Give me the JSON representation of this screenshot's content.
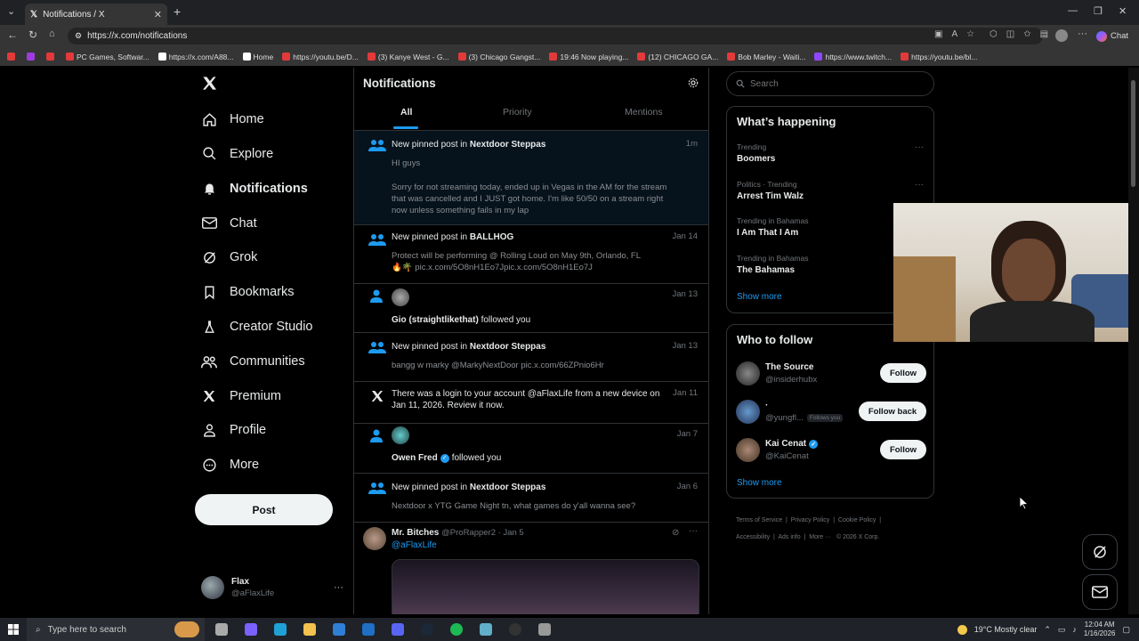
{
  "browser": {
    "tab_title": "Notifications / X",
    "url": "https://x.com/notifications",
    "chat_label": "Chat",
    "bookmarks": [
      {
        "label": "",
        "color": "#e23a3a"
      },
      {
        "label": "",
        "color": "#a03be0"
      },
      {
        "label": "",
        "color": "#e23a3a"
      },
      {
        "label": "PC Games, Softwar...",
        "color": "#e23a3a"
      },
      {
        "label": "https://x.com/A88...",
        "color": "#ffffff"
      },
      {
        "label": "Home",
        "color": "#ffffff"
      },
      {
        "label": "https://youtu.be/D...",
        "color": "#e23a3a"
      },
      {
        "label": "(3) Kanye West - G...",
        "color": "#e23a3a"
      },
      {
        "label": "(3) Chicago Gangst...",
        "color": "#e23a3a"
      },
      {
        "label": "19:46 Now playing...",
        "color": "#e23a3a"
      },
      {
        "label": "(12) CHICAGO GA...",
        "color": "#e23a3a"
      },
      {
        "label": "Bob Marley - Waiti...",
        "color": "#e23a3a"
      },
      {
        "label": "https://www.twitch...",
        "color": "#9146ff"
      },
      {
        "label": "https://youtu.be/bl...",
        "color": "#e23a3a"
      }
    ]
  },
  "nav": {
    "items": [
      {
        "label": "Home",
        "icon": "home-icon"
      },
      {
        "label": "Explore",
        "icon": "search-icon"
      },
      {
        "label": "Notifications",
        "icon": "bell-icon"
      },
      {
        "label": "Chat",
        "icon": "mail-icon"
      },
      {
        "label": "Grok",
        "icon": "grok-icon"
      },
      {
        "label": "Bookmarks",
        "icon": "bookmark-icon"
      },
      {
        "label": "Creator Studio",
        "icon": "flask-icon"
      },
      {
        "label": "Communities",
        "icon": "communities-icon"
      },
      {
        "label": "Premium",
        "icon": "x-logo-icon"
      },
      {
        "label": "Profile",
        "icon": "person-icon"
      },
      {
        "label": "More",
        "icon": "more-circle-icon"
      }
    ],
    "post_label": "Post",
    "account": {
      "name": "Flax",
      "handle": "@aFlaxLife"
    }
  },
  "notifications": {
    "title": "Notifications",
    "tabs": [
      "All",
      "Priority",
      "Mentions"
    ],
    "active_tab": "All",
    "items": [
      {
        "pre": "New pinned post in ",
        "bold": "Nextdoor Steppas",
        "post": "",
        "date": "1m",
        "body1": "HI guys",
        "body2": "Sorry for not streaming today, ended up in Vegas in the AM for the stream that was cancelled and I JUST got home. I'm like 50/50 on a stream right now unless something fails in my lap"
      },
      {
        "pre": "New pinned post in ",
        "bold": "BALLHOG",
        "post": "",
        "date": "Jan 14",
        "body1": "Protect will be performing @ Rolling Loud on May 9th, Orlando, FL",
        "body2": "🔥🌴 pic.x.com/5O8nH1Eo7Jpic.x.com/5O8nH1Eo7J"
      },
      {
        "pre": "",
        "bold": "Gio (straightlikethat)",
        "post": " followed you",
        "date": "Jan 13"
      },
      {
        "pre": "New pinned post in ",
        "bold": "Nextdoor Steppas",
        "post": "",
        "date": "Jan 13",
        "body1": "bangg w marky @MarkyNextDoor pic.x.com/66ZPnio6Hr"
      },
      {
        "pre": "There was a login to your account @aFlaxLife from a new device on Jan 11, 2026. Review it now.",
        "bold": "",
        "post": "",
        "date": "Jan 11"
      },
      {
        "pre": "",
        "bold": "Owen Fred",
        "post": " followed you",
        "date": "Jan 7"
      },
      {
        "pre": "New pinned post in ",
        "bold": "Nextdoor Steppas",
        "post": "",
        "date": "Jan 6",
        "body1": "Nextdoor x YTG Game Night tn, what games do y'all wanna see?"
      },
      {
        "pre": "",
        "bold": "Mr. Bitches",
        "post": "",
        "handle": "@ProRapper2 · Jan 5",
        "mention": "@aFlaxLife"
      }
    ]
  },
  "search": {
    "placeholder": "Search"
  },
  "trends": {
    "title": "What’s happening",
    "items": [
      {
        "context": "Trending",
        "name": "Boomers"
      },
      {
        "context": "Politics · Trending",
        "name": "Arrest Tim Walz"
      },
      {
        "context": "Trending in Bahamas",
        "name": "I Am That I Am"
      },
      {
        "context": "Trending in Bahamas",
        "name": "The Bahamas"
      }
    ],
    "show_more": "Show more"
  },
  "who_to_follow": {
    "title": "Who to follow",
    "items": [
      {
        "name": "The Source",
        "handle": "@insiderhubx",
        "button": "Follow",
        "badge": ""
      },
      {
        "name": "·",
        "handle": "@yungfl...",
        "button": "Follow back",
        "badge": "Follows you"
      },
      {
        "name": "Kai Cenat",
        "handle": "@KaiCenat",
        "button": "Follow",
        "badge": ""
      }
    ],
    "show_more": "Show more"
  },
  "footer": {
    "links": [
      "Terms of Service",
      "Privacy Policy",
      "Cookie Policy",
      "Accessibility",
      "Ads info",
      "More ···",
      "© 2026 X Corp."
    ]
  },
  "taskbar": {
    "search_placeholder": "Type here to search",
    "weather": "19°C  Mostly clear",
    "time": "12:04 AM",
    "date": "1/16/2026"
  },
  "colors": {
    "accent": "#1d9bf0",
    "bg": "#000000"
  }
}
